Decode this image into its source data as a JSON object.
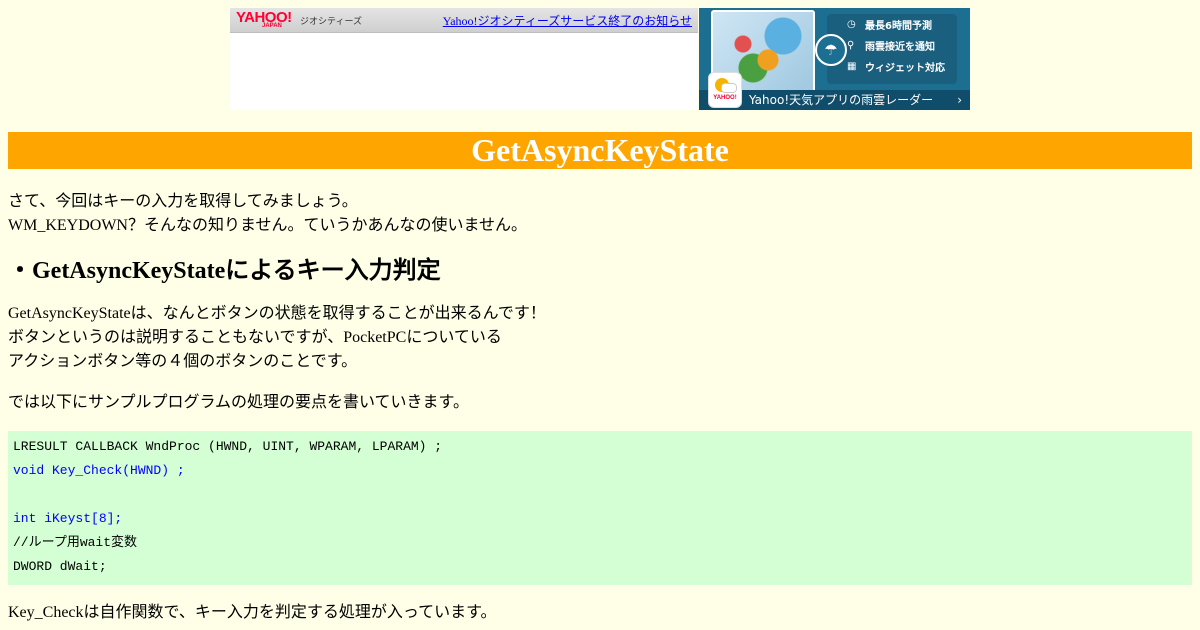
{
  "banner": {
    "yahoo_logo": "YAHOO!",
    "yahoo_sub": "JAPAN",
    "geo_label": "ジオシティーズ",
    "notice_link": "Yahoo!ジオシティーズサービス終了のお知らせ",
    "features": [
      {
        "icon": "clock-icon",
        "glyph": "◷",
        "label": "最長6時間予測"
      },
      {
        "icon": "pin-icon",
        "glyph": "⚲",
        "label": "雨雲接近を通知"
      },
      {
        "icon": "widget-icon",
        "glyph": "▦",
        "label": "ウィジェット対応"
      }
    ],
    "app_label": "Yahoo!天気アプリの雨雲レーダー",
    "app_icon_brand": "YAHOO!",
    "chevron": "›"
  },
  "page": {
    "title": "GetAsyncKeyState",
    "intro_lines": [
      "さて、今回はキーの入力を取得してみましょう。",
      "WM_KEYDOWN？そんなの知りません。ていうかあんなの使いません。"
    ],
    "section_heading": "・GetAsyncKeyStateによるキー入力判定",
    "para1_lines": [
      "GetAsyncKeyStateは、なんとボタンの状態を取得することが出来るんです！",
      "ボタンというのは説明することもないですが、PocketPCについている",
      "アクションボタン等の４個のボタンのことです。"
    ],
    "para2": "では以下にサンプルプログラムの処理の要点を書いていきます。",
    "code_lines": [
      {
        "text": "LRESULT CALLBACK WndProc (HWND, UINT, WPARAM, LPARAM) ;",
        "color": "#000000"
      },
      {
        "text": "void Key_Check(HWND) ;",
        "color": "#0000ff"
      },
      {
        "text": "",
        "color": "#000000"
      },
      {
        "text": "int iKeyst[8];",
        "color": "#0000ff"
      },
      {
        "text": "//ループ用wait変数",
        "color": "#000000"
      },
      {
        "text": "DWORD dWait;",
        "color": "#000000"
      }
    ],
    "para3": "Key_Checkは自作関数で、キー入力を判定する処理が入っています。"
  },
  "colors": {
    "background": "#ffffe8",
    "title_bar": "#ffa500",
    "code_background": "#d4ffd4",
    "code_highlight": "#0000ff",
    "link": "#0000ee"
  }
}
